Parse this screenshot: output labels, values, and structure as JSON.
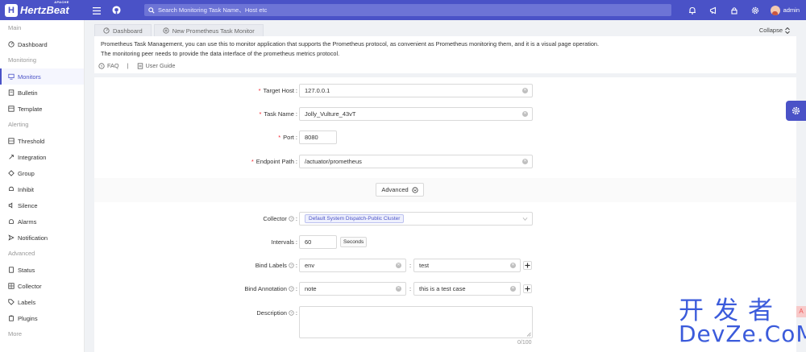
{
  "app": {
    "brand": "HertzBeat",
    "brand_tag": "APACHE"
  },
  "search": {
    "placeholder": "Search Monitoring Task Name、Host etc"
  },
  "user": {
    "name": "admin"
  },
  "sidebar": {
    "groups": [
      {
        "label": "Main",
        "items": [
          {
            "label": "Dashboard",
            "icon": "dashboard-icon"
          }
        ]
      },
      {
        "label": "Monitoring",
        "items": [
          {
            "label": "Monitors",
            "icon": "monitor-icon",
            "active": true
          },
          {
            "label": "Bulletin",
            "icon": "bulletin-icon"
          },
          {
            "label": "Template",
            "icon": "template-icon"
          }
        ]
      },
      {
        "label": "Alerting",
        "items": [
          {
            "label": "Threshold",
            "icon": "threshold-icon"
          },
          {
            "label": "Integration",
            "icon": "integration-icon"
          },
          {
            "label": "Group",
            "icon": "group-icon"
          },
          {
            "label": "Inhibit",
            "icon": "inhibit-icon"
          },
          {
            "label": "Silence",
            "icon": "silence-icon"
          },
          {
            "label": "Alarms",
            "icon": "alarm-icon"
          },
          {
            "label": "Notification",
            "icon": "notification-icon"
          }
        ]
      },
      {
        "label": "Advanced",
        "items": [
          {
            "label": "Status",
            "icon": "status-icon"
          },
          {
            "label": "Collector",
            "icon": "collector-icon"
          },
          {
            "label": "Labels",
            "icon": "labels-icon"
          },
          {
            "label": "Plugins",
            "icon": "plugins-icon"
          }
        ]
      },
      {
        "label": "More",
        "items": []
      }
    ]
  },
  "tabs": [
    {
      "label": "Dashboard",
      "icon": "dashboard-icon"
    },
    {
      "label": "New Prometheus Task Monitor",
      "icon": "plus-circle-icon"
    }
  ],
  "collapse_label": "Collapse",
  "description": {
    "line1": "Prometheus Task Management, you can use this to monitor application that supports the Prometheus protocol, as convenient as Prometheus monitoring them, and it is a visual page operation.",
    "line2": "The monitoring peer needs to provide the data interface of the prometheus metrics protocol.",
    "faq": "FAQ",
    "separator": "|",
    "guide": "User Guide"
  },
  "form": {
    "target_host": {
      "label": "Target Host",
      "value": "127.0.0.1"
    },
    "task_name": {
      "label": "Task Name",
      "value": "Jolly_Vulture_43vT"
    },
    "port": {
      "label": "Port",
      "value": "8080"
    },
    "endpoint_path": {
      "label": "Endpoint Path",
      "value": "/actuator/prometheus"
    },
    "advanced": "Advanced",
    "collector": {
      "label": "Collector",
      "value": "Default System Dispatch-Public Cluster"
    },
    "intervals": {
      "label": "Intervals",
      "value": "60",
      "unit": "Seconds"
    },
    "bind_labels": {
      "label": "Bind Labels",
      "key": "env",
      "value": "test"
    },
    "bind_annotation": {
      "label": "Bind Annotation",
      "key": "note",
      "value": "this is a test case"
    },
    "description": {
      "label": "Description",
      "counter": "0/100"
    },
    "colon": ":"
  },
  "watermark": {
    "line1": "开发者",
    "line2": "DevZe.CoM"
  },
  "colors": {
    "primary": "#4a52c7",
    "required": "#f5222d"
  }
}
